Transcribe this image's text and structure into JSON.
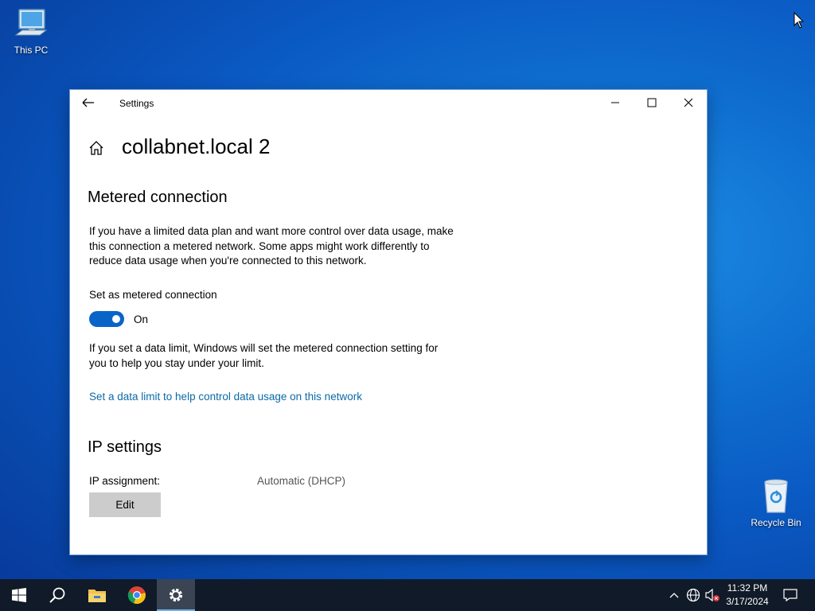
{
  "desktop": {
    "icons": [
      {
        "label": "This PC",
        "icon": "computer-icon"
      },
      {
        "label": "Recycle Bin",
        "icon": "recycle-bin-icon"
      }
    ]
  },
  "window": {
    "app_title": "Settings",
    "page_title": "collabnet.local 2",
    "metered": {
      "heading": "Metered connection",
      "description": "If you have a limited data plan and want more control over data usage, make this connection a metered network. Some apps might work differently to reduce data usage when you're connected to this network.",
      "toggle_label": "Set as metered connection",
      "toggle_state": "On",
      "toggle_on": true,
      "note": "If you set a data limit, Windows will set the metered connection setting for you to help you stay under your limit.",
      "link": "Set a data limit to help control data usage on this network"
    },
    "ip": {
      "heading": "IP settings",
      "assignment_label": "IP assignment:",
      "assignment_value": "Automatic (DHCP)",
      "edit_button": "Edit"
    }
  },
  "taskbar": {
    "pinned": [
      "start-icon",
      "search-icon",
      "file-explorer-icon",
      "chrome-icon",
      "settings-icon"
    ],
    "clock": {
      "time": "11:32 PM",
      "date": "3/17/2024"
    },
    "colors": {
      "taskbar_bg": "#101a28",
      "accent": "#0a64c8",
      "link": "#0b6aa8"
    }
  }
}
